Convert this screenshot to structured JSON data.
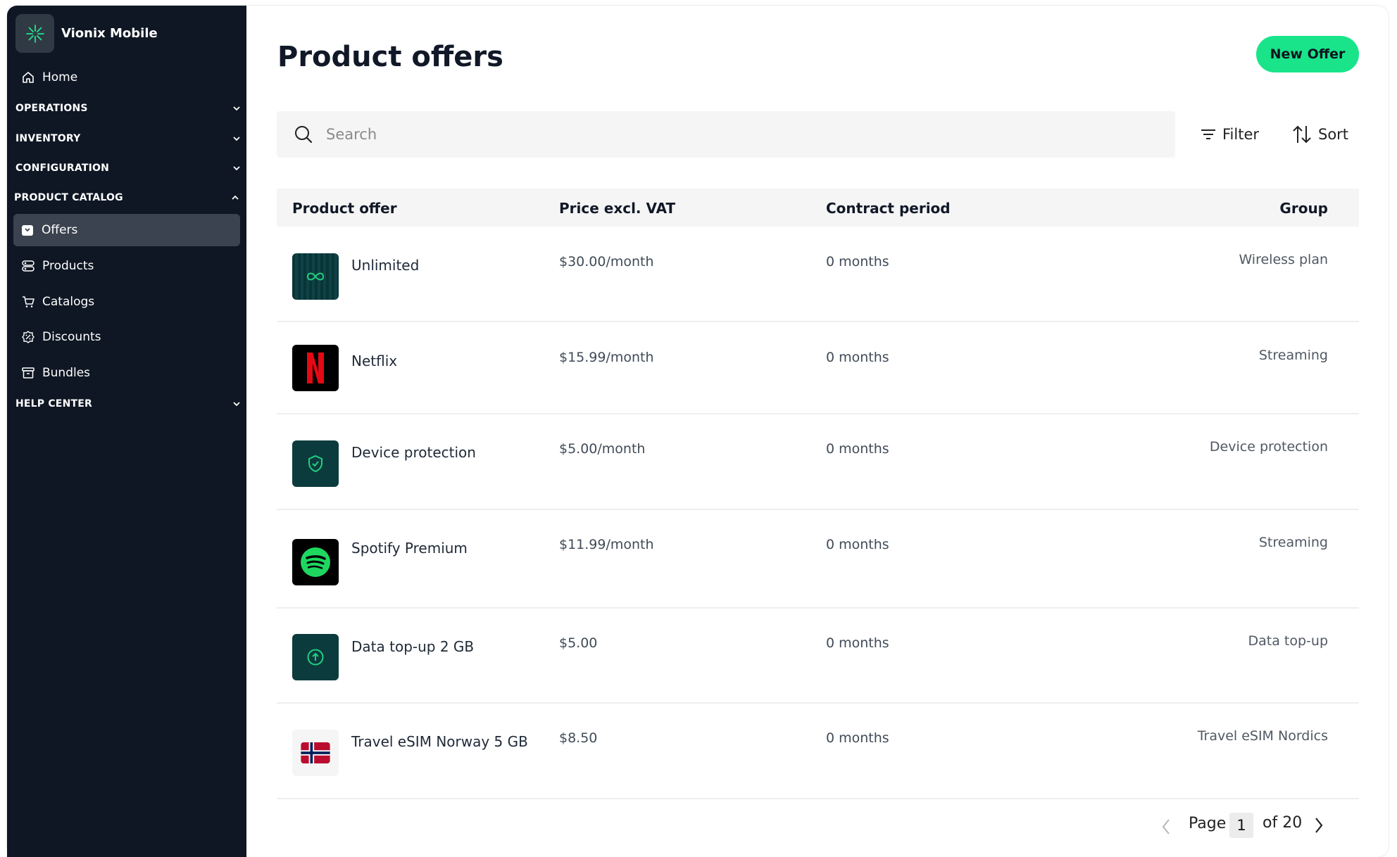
{
  "brand": {
    "name": "Vionix Mobile"
  },
  "sidebar": {
    "home": "Home",
    "sections": {
      "operations": "OPERATIONS",
      "inventory": "INVENTORY",
      "configuration": "CONFIGURATION",
      "product_catalog": "PRODUCT CATALOG",
      "help_center": "HELP CENTER"
    },
    "catalog_items": [
      "Offers",
      "Products",
      "Catalogs",
      "Discounts",
      "Bundles"
    ],
    "active_item": "Offers"
  },
  "main": {
    "title": "Product offers",
    "new_offer_label": "New Offer",
    "search_placeholder": "Search",
    "filter_label": "Filter",
    "sort_label": "Sort"
  },
  "table": {
    "headers": [
      "Product offer",
      "Price excl. VAT",
      "Contract period",
      "Group"
    ],
    "rows": [
      {
        "name": "Unlimited",
        "price": "$30.00/month",
        "period": "0 months",
        "group": "Wireless plan",
        "icon": "infinity-icon"
      },
      {
        "name": "Netflix",
        "price": "$15.99/month",
        "period": "0 months",
        "group": "Streaming",
        "icon": "netflix-logo"
      },
      {
        "name": "Device protection",
        "price": "$5.00/month",
        "period": "0 months",
        "group": "Device protection",
        "icon": "shield-check-icon"
      },
      {
        "name": "Spotify Premium",
        "price": "$11.99/month",
        "period": "0 months",
        "group": "Streaming",
        "icon": "spotify-logo"
      },
      {
        "name": "Data top-up 2 GB",
        "price": "$5.00",
        "period": "0 months",
        "group": "Data top-up",
        "icon": "arrow-up-circle-icon"
      },
      {
        "name": "Travel eSIM Norway 5 GB",
        "price": "$8.50",
        "period": "0 months",
        "group": "Travel eSIM Nordics",
        "icon": "norway-flag-icon"
      }
    ]
  },
  "pagination": {
    "page_label": "Page",
    "current": "1",
    "of_label": "of 20"
  },
  "colors": {
    "sidebar_bg": "#0f1724",
    "active_item_bg": "#3b4350",
    "accent": "#19e48a",
    "tile_bg": "#0c3b3d",
    "tile_icon": "#22d07f"
  }
}
